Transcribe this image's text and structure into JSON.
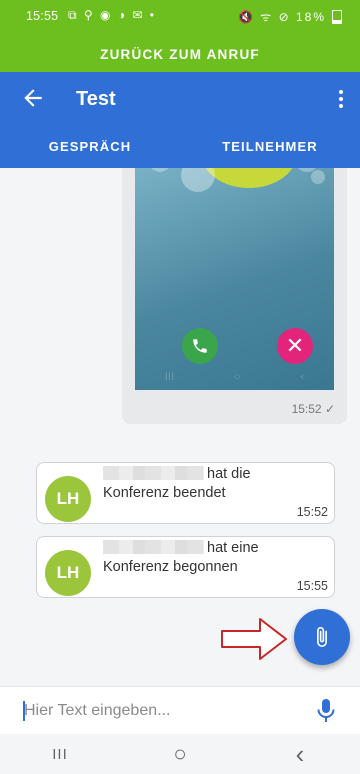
{
  "status_bar": {
    "time": "15:55",
    "left_icons": "⧉ ⚲ ◉ ◑ ✉ •",
    "right_icons": "🔇 ᯤ ⊘",
    "battery": "18%"
  },
  "return_banner": {
    "label": "ZURÜCK ZUM ANRUF"
  },
  "toolbar": {
    "title": "Test"
  },
  "tabs": [
    {
      "label": "GESPRÄCH"
    },
    {
      "label": "TEILNEHMER"
    }
  ],
  "image_message": {
    "time": "15:52 ✓"
  },
  "system_messages": [
    {
      "avatar": "LH",
      "line1": "hat die",
      "line2": "Konferenz beendet",
      "time": "15:52"
    },
    {
      "avatar": "LH",
      "line1": "hat eine",
      "line2": "Konferenz begonnen",
      "time": "15:55"
    }
  ],
  "input": {
    "placeholder": "Hier Text eingeben..."
  },
  "nav": {
    "recents": "III",
    "home": "○",
    "back": "‹"
  },
  "colors": {
    "green": "#6cbf1e",
    "blue": "#2f6fd6",
    "avatar": "#9bc63c",
    "decline": "#e2247a",
    "accept": "#3aa54a"
  }
}
